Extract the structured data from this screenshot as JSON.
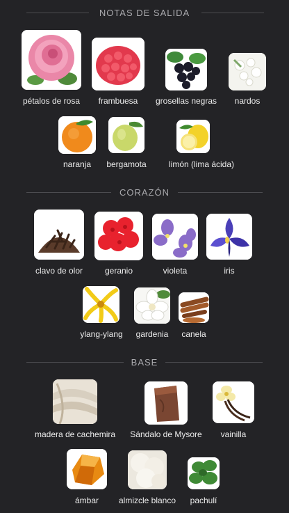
{
  "sections": [
    {
      "title": "NOTAS DE SALIDA",
      "items": [
        {
          "label": "pétalos de rosa",
          "icon": "rose-photo"
        },
        {
          "label": "frambuesa",
          "icon": "raspberry-photo"
        },
        {
          "label": "grosellas negras",
          "icon": "blackcurrant-photo"
        },
        {
          "label": "nardos",
          "icon": "tuberose-photo"
        },
        {
          "label": "naranja",
          "icon": "orange-photo"
        },
        {
          "label": "bergamota",
          "icon": "bergamot-photo"
        },
        {
          "label": "limón (lima ácida)",
          "icon": "lemon-photo"
        }
      ]
    },
    {
      "title": "CORAZÓN",
      "items": [
        {
          "label": "clavo de olor",
          "icon": "clove-photo"
        },
        {
          "label": "geranio",
          "icon": "geranium-photo"
        },
        {
          "label": "violeta",
          "icon": "violet-photo"
        },
        {
          "label": "iris",
          "icon": "iris-photo"
        },
        {
          "label": "ylang-ylang",
          "icon": "ylang-ylang-photo"
        },
        {
          "label": "gardenia",
          "icon": "gardenia-photo"
        },
        {
          "label": "canela",
          "icon": "cinnamon-photo"
        }
      ]
    },
    {
      "title": "BASE",
      "items": [
        {
          "label": "madera de cachemira",
          "icon": "cashmere-wood-photo"
        },
        {
          "label": "Sándalo de Mysore",
          "icon": "sandalwood-photo"
        },
        {
          "label": "vainilla",
          "icon": "vanilla-photo"
        },
        {
          "label": "ámbar",
          "icon": "amber-photo"
        },
        {
          "label": "almizcle blanco",
          "icon": "white-musk-photo"
        },
        {
          "label": "pachulí",
          "icon": "patchouli-photo"
        }
      ]
    }
  ],
  "colors": {
    "background": "#232326",
    "header_text": "#a9a9ad",
    "label_text": "#ececec"
  }
}
